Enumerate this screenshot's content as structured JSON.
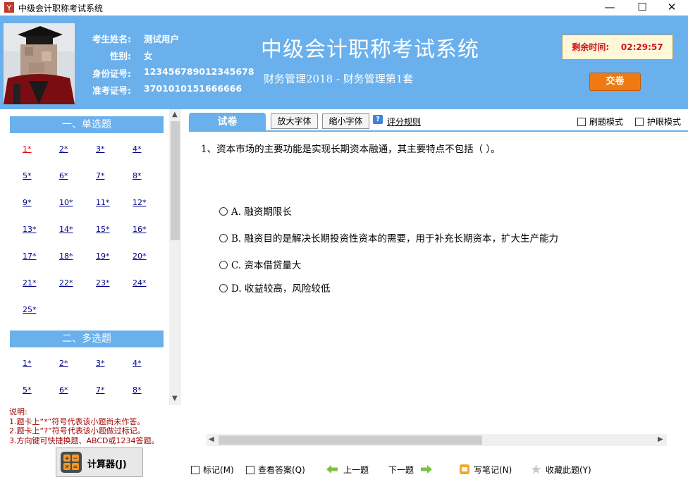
{
  "window": {
    "title": "中级会计职称考试系统",
    "minimize": "—",
    "maximize": "☐",
    "close": "✕"
  },
  "candidate": {
    "name_label": "考生姓名:",
    "name": "测试用户",
    "gender_label": "性别:",
    "gender": "女",
    "id_label": "身份证号:",
    "id": "123456789012345678",
    "ticket_label": "准考证号:",
    "ticket": "3701010151666666"
  },
  "header": {
    "title": "中级会计职称考试系统",
    "subtitle": "财务管理2018 - 财务管理第1套"
  },
  "timer": {
    "label": "剩余时间:",
    "value": "02:29:57"
  },
  "submit_label": "交卷",
  "sections": [
    {
      "title": "一、单选题",
      "items": [
        "1*",
        "2*",
        "3*",
        "4*",
        "5*",
        "6*",
        "7*",
        "8*",
        "9*",
        "10*",
        "11*",
        "12*",
        "13*",
        "14*",
        "15*",
        "16*",
        "17*",
        "18*",
        "19*",
        "20*",
        "21*",
        "22*",
        "23*",
        "24*",
        "25*"
      ]
    },
    {
      "title": "二、多选题",
      "items": [
        "1*",
        "2*",
        "3*",
        "4*",
        "5*",
        "6*",
        "7*",
        "8*"
      ]
    }
  ],
  "notes": [
    "说明:",
    "1.题卡上“*”符号代表该小题尚未作答。",
    "2.题卡上“?”符号代表该小题做过标记。",
    "3.方向键可快捷换题、ABCD或1234答题。"
  ],
  "calculator_label": "计算器(J)",
  "toolbar": {
    "tab": "试卷",
    "enlarge": "放大字体",
    "shrink": "缩小字体",
    "rules": "评分规则",
    "practice_mode": "刷题模式",
    "eye_mode": "护眼模式"
  },
  "question": {
    "text": "1、资本市场的主要功能是实现长期资本融通，其主要特点不包括（  ）。",
    "options": [
      "A.  融资期限长",
      "B.  融资目的是解决长期投资性资本的需要，用于补充长期资本，扩大生产能力",
      "C.  资本借贷量大",
      "D.  收益较高，风险较低"
    ]
  },
  "bottom": {
    "mark": "标记(M)",
    "view_answer": "查看答案(Q)",
    "prev": "上一题",
    "next": "下一题",
    "notes": "写笔记(N)",
    "favorite": "收藏此题(Y)"
  },
  "colors": {
    "header_blue": "#6ab0ec",
    "submit_orange": "#f07a12",
    "timer_red": "#d0141a",
    "link_blue": "#00008b",
    "note_red": "#9e0000"
  }
}
